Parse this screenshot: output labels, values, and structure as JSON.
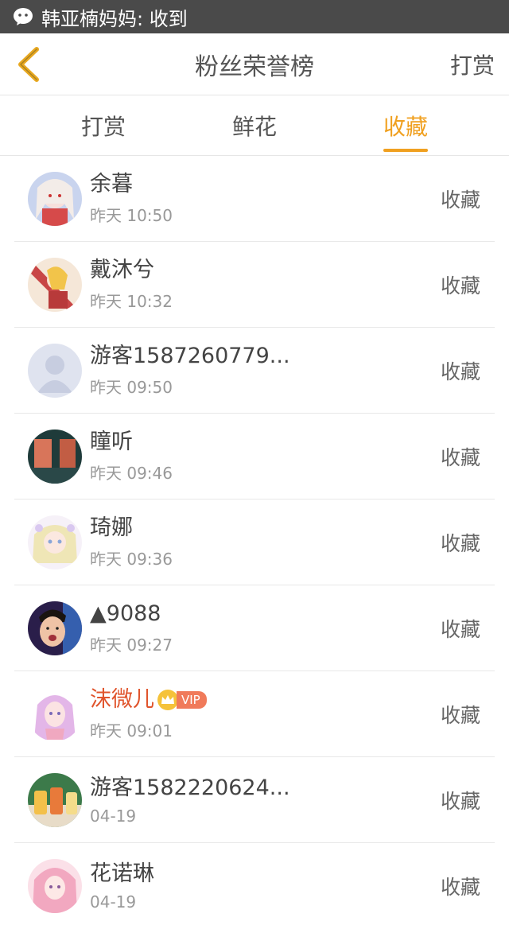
{
  "status_bar": {
    "notification_icon": "wechat-icon",
    "text": "韩亚楠妈妈: 收到"
  },
  "header": {
    "back_icon": "chevron-left-icon",
    "title": "粉丝荣誉榜",
    "right_action": "打赏"
  },
  "tabs": [
    {
      "label": "打赏",
      "active": false
    },
    {
      "label": "鲜花",
      "active": false
    },
    {
      "label": "收藏",
      "active": true
    }
  ],
  "colors": {
    "accent": "#f0a020",
    "vip_name": "#e0542c",
    "status_bar_bg": "#4a4a4a"
  },
  "fans": [
    {
      "name": "余暮",
      "time": "昨天 10:50",
      "action": "收藏",
      "avatar": "anime-girl-avatar"
    },
    {
      "name": "戴沐兮",
      "time": "昨天 10:32",
      "action": "收藏",
      "avatar": "anime-girl-avatar"
    },
    {
      "name": "游客1587260779...",
      "time": "昨天 09:50",
      "action": "收藏",
      "avatar": "default-user-avatar"
    },
    {
      "name": "瞳听",
      "time": "昨天 09:46",
      "action": "收藏",
      "avatar": "scenery-avatar"
    },
    {
      "name": "琦娜",
      "time": "昨天 09:36",
      "action": "收藏",
      "avatar": "anime-girl-avatar"
    },
    {
      "name": "▲9088",
      "time": "昨天 09:27",
      "action": "收藏",
      "avatar": "boy-photo-avatar"
    },
    {
      "name": "沫微儿",
      "time": "昨天 09:01",
      "action": "收藏",
      "avatar": "anime-girl-avatar",
      "vip": true,
      "vip_label": "VIP",
      "vip_icon": "crown-icon"
    },
    {
      "name": "游客1582220624...",
      "time": "04-19",
      "action": "收藏",
      "avatar": "drinks-photo-avatar"
    },
    {
      "name": "花诺琳",
      "time": "04-19",
      "action": "收藏",
      "avatar": "anime-girl-avatar"
    }
  ]
}
